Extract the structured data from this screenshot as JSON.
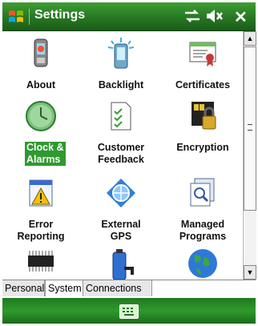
{
  "window": {
    "title": "Settings"
  },
  "titlebar": {
    "connectivity_icon": "connectivity-icon",
    "volume_icon": "volume-icon",
    "close_glyph": "✕"
  },
  "settings": [
    {
      "label": "About",
      "icon": "about-icon"
    },
    {
      "label": "Backlight",
      "icon": "backlight-icon"
    },
    {
      "label": "Certificates",
      "icon": "certificates-icon"
    },
    {
      "label": "Clock &\nAlarms",
      "icon": "clock-icon",
      "selected": true
    },
    {
      "label": "Customer\nFeedback",
      "icon": "customer-feedback-icon"
    },
    {
      "label": "Encryption",
      "icon": "encryption-icon"
    },
    {
      "label": "Error\nReporting",
      "icon": "error-reporting-icon"
    },
    {
      "label": "External\nGPS",
      "icon": "external-gps-icon"
    },
    {
      "label": "Managed\nPrograms",
      "icon": "managed-programs-icon"
    }
  ],
  "tabs": [
    "Personal",
    "System",
    "Connections"
  ],
  "active_tab": "System",
  "colors": {
    "accent_green": "#2a7d25",
    "selection_green": "#2f9a2f"
  }
}
